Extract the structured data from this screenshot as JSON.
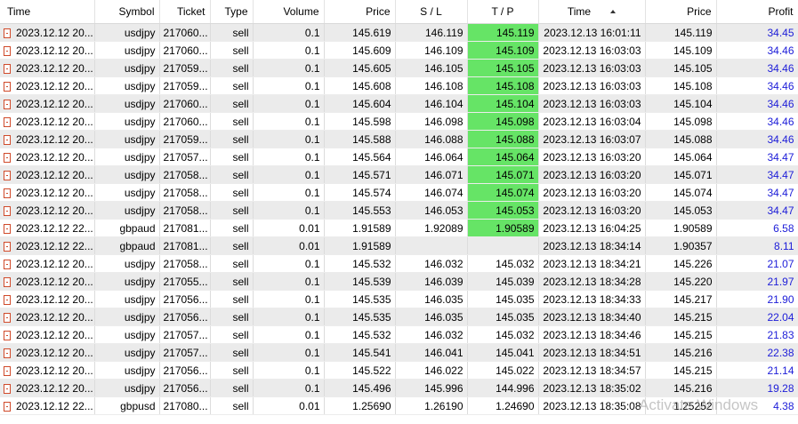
{
  "columns": [
    "Time",
    "Symbol",
    "Ticket",
    "Type",
    "Volume",
    "Price",
    "S / L",
    "T / P",
    "Time",
    "Price",
    "Profit"
  ],
  "rows": [
    {
      "open_time": "2023.12.12 20...",
      "symbol": "usdjpy",
      "ticket": "217060...",
      "type": "sell",
      "volume": "0.1",
      "open_price": "145.619",
      "sl": "146.119",
      "tp": "145.119",
      "close_time": "2023.12.13 16:01:11",
      "close_price": "145.119",
      "profit": "34.45"
    },
    {
      "open_time": "2023.12.12 20...",
      "symbol": "usdjpy",
      "ticket": "217060...",
      "type": "sell",
      "volume": "0.1",
      "open_price": "145.609",
      "sl": "146.109",
      "tp": "145.109",
      "close_time": "2023.12.13 16:03:03",
      "close_price": "145.109",
      "profit": "34.46"
    },
    {
      "open_time": "2023.12.12 20...",
      "symbol": "usdjpy",
      "ticket": "217059...",
      "type": "sell",
      "volume": "0.1",
      "open_price": "145.605",
      "sl": "146.105",
      "tp": "145.105",
      "close_time": "2023.12.13 16:03:03",
      "close_price": "145.105",
      "profit": "34.46"
    },
    {
      "open_time": "2023.12.12 20...",
      "symbol": "usdjpy",
      "ticket": "217059...",
      "type": "sell",
      "volume": "0.1",
      "open_price": "145.608",
      "sl": "146.108",
      "tp": "145.108",
      "close_time": "2023.12.13 16:03:03",
      "close_price": "145.108",
      "profit": "34.46"
    },
    {
      "open_time": "2023.12.12 20...",
      "symbol": "usdjpy",
      "ticket": "217060...",
      "type": "sell",
      "volume": "0.1",
      "open_price": "145.604",
      "sl": "146.104",
      "tp": "145.104",
      "close_time": "2023.12.13 16:03:03",
      "close_price": "145.104",
      "profit": "34.46"
    },
    {
      "open_time": "2023.12.12 20...",
      "symbol": "usdjpy",
      "ticket": "217060...",
      "type": "sell",
      "volume": "0.1",
      "open_price": "145.598",
      "sl": "146.098",
      "tp": "145.098",
      "close_time": "2023.12.13 16:03:04",
      "close_price": "145.098",
      "profit": "34.46"
    },
    {
      "open_time": "2023.12.12 20...",
      "symbol": "usdjpy",
      "ticket": "217059...",
      "type": "sell",
      "volume": "0.1",
      "open_price": "145.588",
      "sl": "146.088",
      "tp": "145.088",
      "close_time": "2023.12.13 16:03:07",
      "close_price": "145.088",
      "profit": "34.46"
    },
    {
      "open_time": "2023.12.12 20...",
      "symbol": "usdjpy",
      "ticket": "217057...",
      "type": "sell",
      "volume": "0.1",
      "open_price": "145.564",
      "sl": "146.064",
      "tp": "145.064",
      "close_time": "2023.12.13 16:03:20",
      "close_price": "145.064",
      "profit": "34.47"
    },
    {
      "open_time": "2023.12.12 20...",
      "symbol": "usdjpy",
      "ticket": "217058...",
      "type": "sell",
      "volume": "0.1",
      "open_price": "145.571",
      "sl": "146.071",
      "tp": "145.071",
      "close_time": "2023.12.13 16:03:20",
      "close_price": "145.071",
      "profit": "34.47"
    },
    {
      "open_time": "2023.12.12 20...",
      "symbol": "usdjpy",
      "ticket": "217058...",
      "type": "sell",
      "volume": "0.1",
      "open_price": "145.574",
      "sl": "146.074",
      "tp": "145.074",
      "close_time": "2023.12.13 16:03:20",
      "close_price": "145.074",
      "profit": "34.47"
    },
    {
      "open_time": "2023.12.12 20...",
      "symbol": "usdjpy",
      "ticket": "217058...",
      "type": "sell",
      "volume": "0.1",
      "open_price": "145.553",
      "sl": "146.053",
      "tp": "145.053",
      "close_time": "2023.12.13 16:03:20",
      "close_price": "145.053",
      "profit": "34.47"
    },
    {
      "open_time": "2023.12.12 22...",
      "symbol": "gbpaud",
      "ticket": "217081...",
      "type": "sell",
      "volume": "0.01",
      "open_price": "1.91589",
      "sl": "1.92089",
      "tp": "1.90589",
      "close_time": "2023.12.13 16:04:25",
      "close_price": "1.90589",
      "profit": "6.58"
    },
    {
      "open_time": "2023.12.12 22...",
      "symbol": "gbpaud",
      "ticket": "217081...",
      "type": "sell",
      "volume": "0.01",
      "open_price": "1.91589",
      "sl": "",
      "tp": "",
      "close_time": "2023.12.13 18:34:14",
      "close_price": "1.90357",
      "profit": "8.11"
    },
    {
      "open_time": "2023.12.12 20...",
      "symbol": "usdjpy",
      "ticket": "217058...",
      "type": "sell",
      "volume": "0.1",
      "open_price": "145.532",
      "sl": "146.032",
      "tp": "145.032",
      "close_time": "2023.12.13 18:34:21",
      "close_price": "145.226",
      "profit": "21.07"
    },
    {
      "open_time": "2023.12.12 20...",
      "symbol": "usdjpy",
      "ticket": "217055...",
      "type": "sell",
      "volume": "0.1",
      "open_price": "145.539",
      "sl": "146.039",
      "tp": "145.039",
      "close_time": "2023.12.13 18:34:28",
      "close_price": "145.220",
      "profit": "21.97"
    },
    {
      "open_time": "2023.12.12 20...",
      "symbol": "usdjpy",
      "ticket": "217056...",
      "type": "sell",
      "volume": "0.1",
      "open_price": "145.535",
      "sl": "146.035",
      "tp": "145.035",
      "close_time": "2023.12.13 18:34:33",
      "close_price": "145.217",
      "profit": "21.90"
    },
    {
      "open_time": "2023.12.12 20...",
      "symbol": "usdjpy",
      "ticket": "217056...",
      "type": "sell",
      "volume": "0.1",
      "open_price": "145.535",
      "sl": "146.035",
      "tp": "145.035",
      "close_time": "2023.12.13 18:34:40",
      "close_price": "145.215",
      "profit": "22.04"
    },
    {
      "open_time": "2023.12.12 20...",
      "symbol": "usdjpy",
      "ticket": "217057...",
      "type": "sell",
      "volume": "0.1",
      "open_price": "145.532",
      "sl": "146.032",
      "tp": "145.032",
      "close_time": "2023.12.13 18:34:46",
      "close_price": "145.215",
      "profit": "21.83"
    },
    {
      "open_time": "2023.12.12 20...",
      "symbol": "usdjpy",
      "ticket": "217057...",
      "type": "sell",
      "volume": "0.1",
      "open_price": "145.541",
      "sl": "146.041",
      "tp": "145.041",
      "close_time": "2023.12.13 18:34:51",
      "close_price": "145.216",
      "profit": "22.38"
    },
    {
      "open_time": "2023.12.12 20...",
      "symbol": "usdjpy",
      "ticket": "217056...",
      "type": "sell",
      "volume": "0.1",
      "open_price": "145.522",
      "sl": "146.022",
      "tp": "145.022",
      "close_time": "2023.12.13 18:34:57",
      "close_price": "145.215",
      "profit": "21.14"
    },
    {
      "open_time": "2023.12.12 20...",
      "symbol": "usdjpy",
      "ticket": "217056...",
      "type": "sell",
      "volume": "0.1",
      "open_price": "145.496",
      "sl": "145.996",
      "tp": "144.996",
      "close_time": "2023.12.13 18:35:02",
      "close_price": "145.216",
      "profit": "19.28"
    },
    {
      "open_time": "2023.12.12 22...",
      "symbol": "gbpusd",
      "ticket": "217080...",
      "type": "sell",
      "volume": "0.01",
      "open_price": "1.25690",
      "sl": "1.26190",
      "tp": "1.24690",
      "close_time": "2023.12.13 18:35:08",
      "close_price": "1.25252",
      "profit": "4.38"
    }
  ],
  "tp_hit_rows": 12,
  "colors": {
    "tp_hit_bg": "#66e466",
    "profit_text": "#1c1cd8",
    "row_alt_bg": "#ebebeb",
    "icon_accent": "#d04a2a"
  },
  "sort": {
    "column": "close_time",
    "direction": "ascending"
  },
  "watermark": "Activate Windows"
}
